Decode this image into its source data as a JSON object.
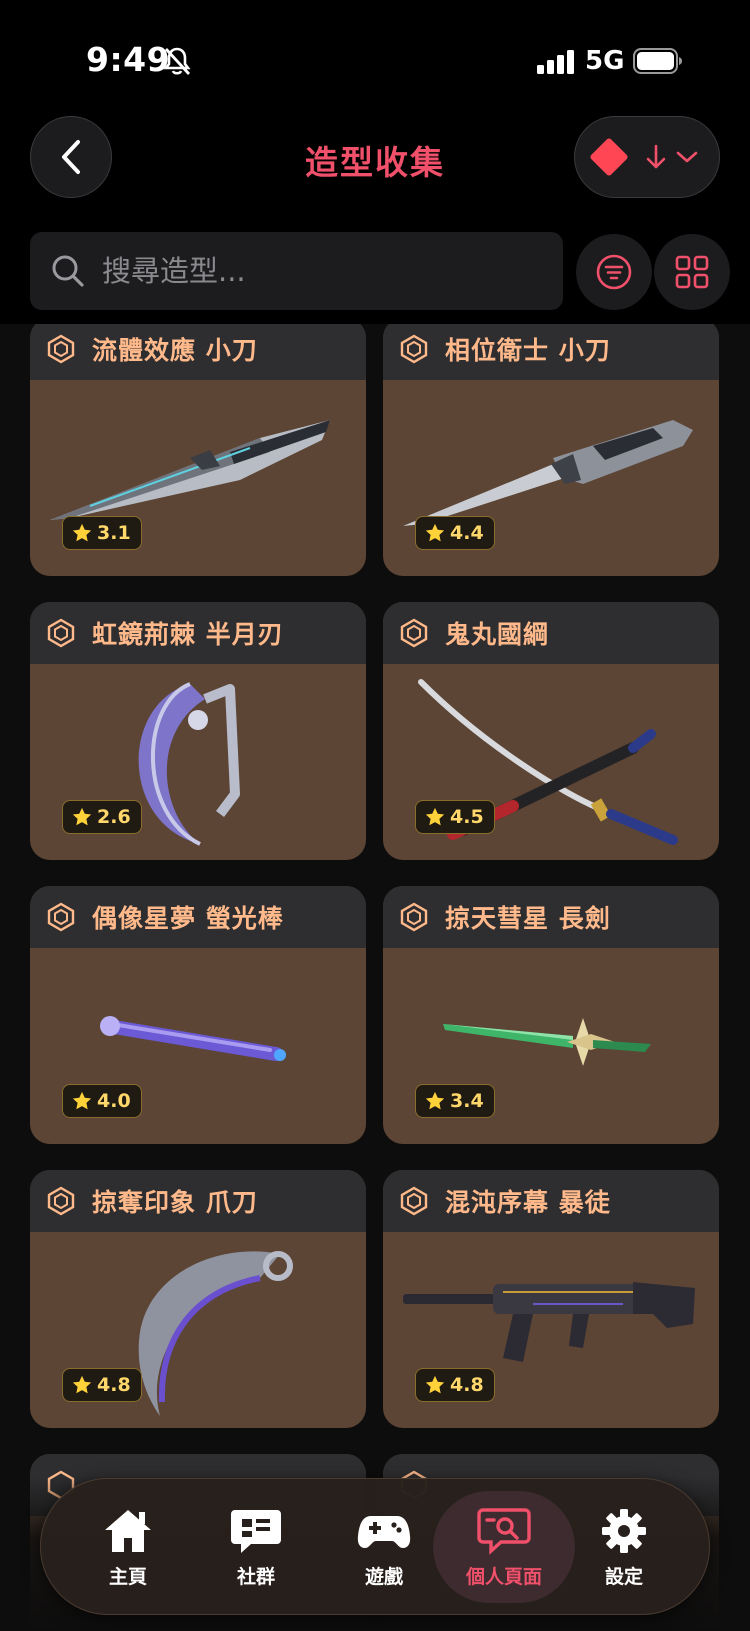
{
  "status_bar": {
    "time": "9:49",
    "network": "5G"
  },
  "header": {
    "title": "造型收集"
  },
  "search": {
    "placeholder": "搜尋造型..."
  },
  "cards": [
    {
      "name": "流體效應 小刀",
      "rating": "3.1"
    },
    {
      "name": "相位衛士 小刀",
      "rating": "4.4"
    },
    {
      "name": "虹鏡荊棘 半月刃",
      "rating": "2.6"
    },
    {
      "name": "鬼丸國綱",
      "rating": "4.5"
    },
    {
      "name": "偶像星夢 螢光棒",
      "rating": "4.0"
    },
    {
      "name": "掠天彗星 長劍",
      "rating": "3.4"
    },
    {
      "name": "掠奪印象 爪刀",
      "rating": "4.8"
    },
    {
      "name": "混沌序幕 暴徒",
      "rating": "4.8"
    }
  ],
  "nav": {
    "home": "主頁",
    "community": "社群",
    "games": "遊戲",
    "profile": "個人頁面",
    "settings": "設定"
  },
  "colors": {
    "accent": "#f0506a",
    "card_title": "#ffb98a",
    "card_body": "#5c4535",
    "rating": "#ffd76a"
  }
}
